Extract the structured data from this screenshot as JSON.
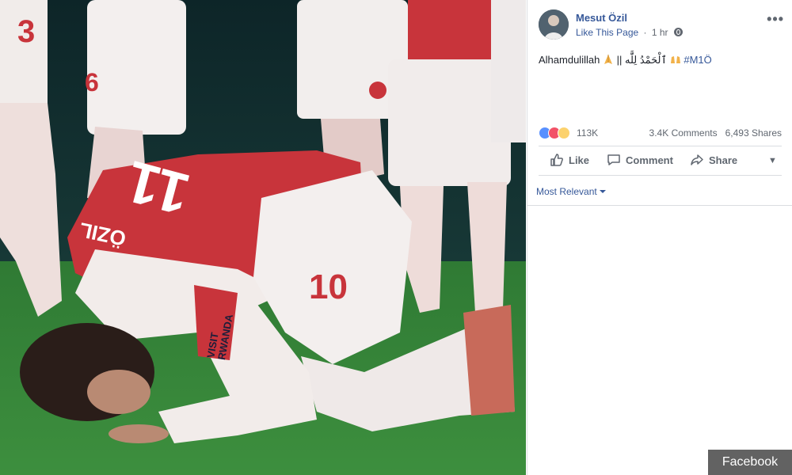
{
  "post": {
    "page_name": "Mesut Özil",
    "like_page": "Like This Page",
    "dot": "·",
    "time": "1 hr",
    "text_main": "Alhamdulillah",
    "text_sep": "||",
    "text_arabic": "ٱلْحَمْدُ لِلَّٰه",
    "hashtag": "#M1Ö"
  },
  "photo": {
    "player_name": "ÖZIL",
    "back_number": "11",
    "shorts_number": "10",
    "sponsor": "VISIT RWANDA",
    "sock_number_left": "3",
    "sock_number_right": "6"
  },
  "reactions": {
    "types": [
      "like-icon",
      "love-icon",
      "wow-icon"
    ],
    "count": "113K",
    "comments": "3.4K Comments",
    "shares": "6,493 Shares"
  },
  "actions": {
    "like": "Like",
    "comment": "Comment",
    "share": "Share"
  },
  "comments": {
    "sort_label": "Most Relevant"
  },
  "watermark": "Facebook",
  "colors": {
    "link": "#365899",
    "text": "#1d2129",
    "muted": "#606770",
    "kit_red": "#c8343b"
  }
}
